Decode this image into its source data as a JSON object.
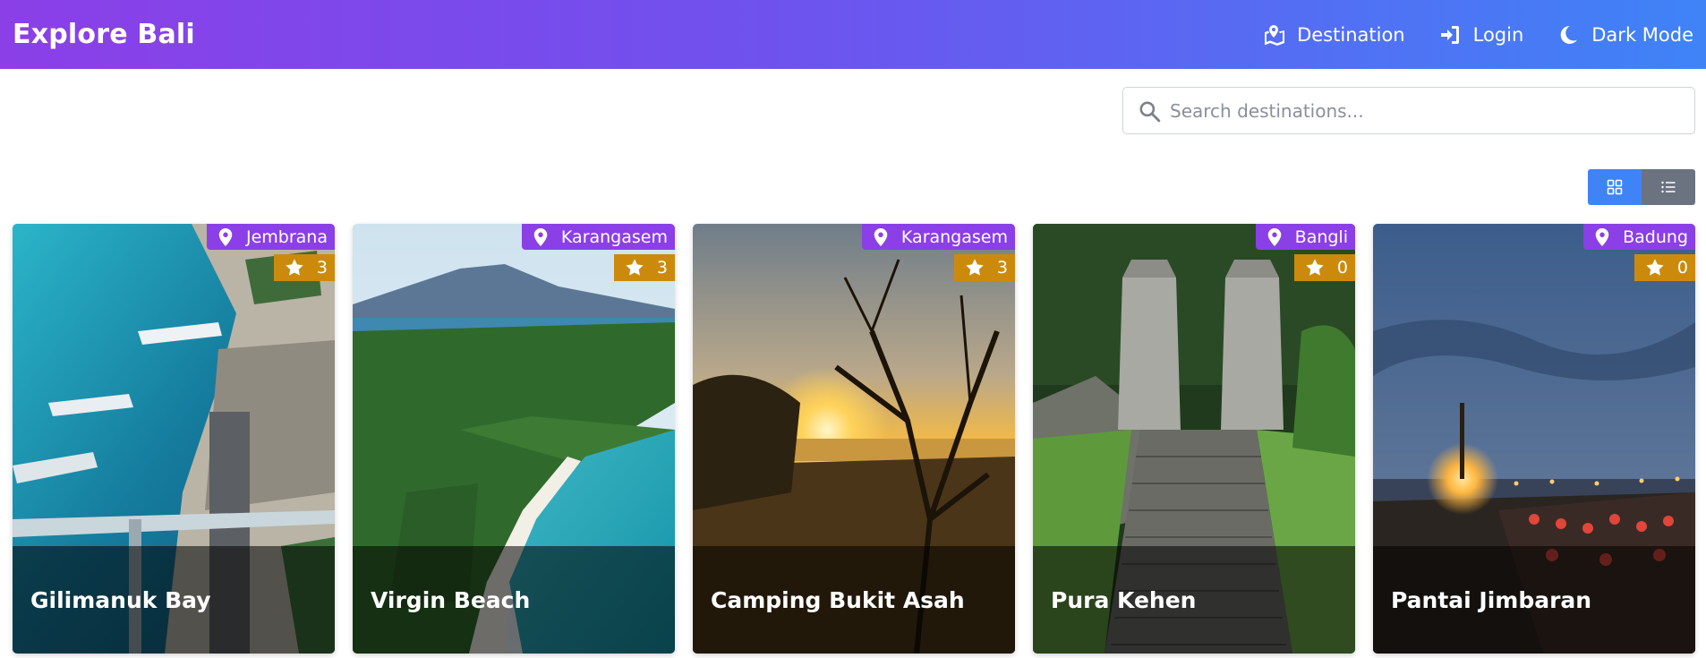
{
  "navbar": {
    "brand": "Explore Bali",
    "links": [
      {
        "label": "Destination",
        "icon": "map-marked-icon"
      },
      {
        "label": "Login",
        "icon": "sign-in-icon"
      },
      {
        "label": "Dark Mode",
        "icon": "moon-icon"
      }
    ]
  },
  "search": {
    "placeholder": "Search destinations...",
    "value": ""
  },
  "view_toggle": {
    "active": "grid",
    "options": [
      "grid-icon",
      "list-icon"
    ],
    "active_color": "#3f83f7",
    "inactive_color": "#6b7280"
  },
  "colors": {
    "accent_purple": "#8b3fe7",
    "accent_blue": "#3f83f7",
    "rating_badge": "#cc8a0c"
  },
  "cards": [
    {
      "title": "Gilimanuk Bay",
      "region": "Jembrana",
      "rating": "3"
    },
    {
      "title": "Virgin Beach",
      "region": "Karangasem",
      "rating": "3"
    },
    {
      "title": "Camping Bukit Asah",
      "region": "Karangasem",
      "rating": "3"
    },
    {
      "title": "Pura Kehen",
      "region": "Bangli",
      "rating": "0"
    },
    {
      "title": "Pantai Jimbaran",
      "region": "Badung",
      "rating": "0"
    }
  ]
}
